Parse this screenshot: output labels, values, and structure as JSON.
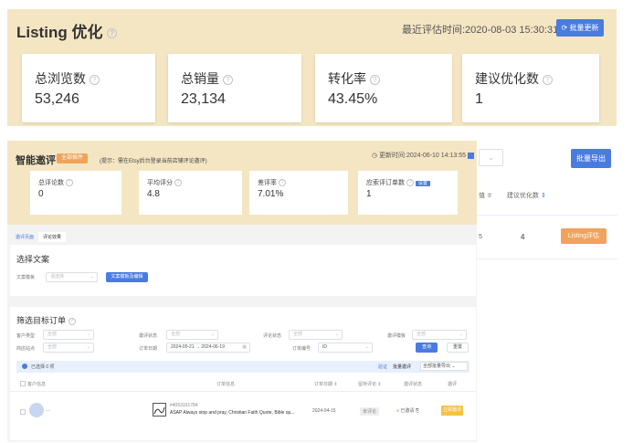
{
  "listing": {
    "title": "Listing 优化",
    "time_label": "最近评估时间:2020-08-03 15:30:31",
    "refresh_button": "批量更新",
    "stats": [
      {
        "label": "总浏览数",
        "value": "53,246"
      },
      {
        "label": "总销量",
        "value": "23,134"
      },
      {
        "label": "转化率",
        "value": "43.45%"
      },
      {
        "label": "建议优化数",
        "value": "1"
      }
    ]
  },
  "right_panel": {
    "export_button": "批量导出",
    "column_partial": "值 ≑",
    "column_suggest": "建议优化数",
    "row_partial": "5",
    "row_value": "4",
    "row_action": "Listing评估"
  },
  "smart": {
    "title": "智能邀评",
    "badge": "全部插件",
    "tip": "(提示：需在Etsy后台登录当前店铺评论邀评)",
    "update_time": "更新时间:2024-06-10 14:13:55",
    "stats": [
      {
        "label": "总评论数",
        "value": "0"
      },
      {
        "label": "平均评分",
        "value": "4.8"
      },
      {
        "label": "差评率",
        "value": "7.01%"
      },
      {
        "label": "应索评订单数",
        "value": "1",
        "tag": "设置"
      }
    ],
    "tabs": [
      "邀评页面",
      "评论效果"
    ],
    "copy_section": {
      "title": "选择文案",
      "field_label": "文案模板",
      "field_value": "请选择",
      "button": "文案模板及编辑"
    },
    "filter_section": {
      "title": "筛选目标订单",
      "row1": [
        {
          "label": "客户类型",
          "value": "全部"
        },
        {
          "label": "邀评状态",
          "value": "全部"
        },
        {
          "label": "评论状态",
          "value": "全部"
        },
        {
          "label": "邀评模板",
          "value": "全部"
        }
      ],
      "row2": {
        "site_label": "商店站点",
        "site_value": "全部",
        "date_label": "订单日期",
        "date_start": "2024-05-21",
        "date_sep": "→",
        "date_end": "2024-06-19",
        "order_label": "订单编号",
        "order_value": "ID"
      },
      "search_button": "查询",
      "reset_button": "重置"
    },
    "selection_bar": {
      "selected": "已选择 0 项",
      "verify": "验证",
      "batch": "批量邀评",
      "batch_export": "全部批量导出"
    },
    "table": {
      "headers": [
        "客户信息",
        "订单信息",
        "订单日期",
        "留存评论",
        "邀评状态",
        "邀评"
      ],
      "row": {
        "order_no": "#4053101784",
        "product": "ASAP Always stop and pray, Christian Faith Quote, Bible qu...",
        "date": "2024-04-15",
        "comment": "未评论",
        "status": "已邀请",
        "action": "立即邀评"
      }
    }
  }
}
